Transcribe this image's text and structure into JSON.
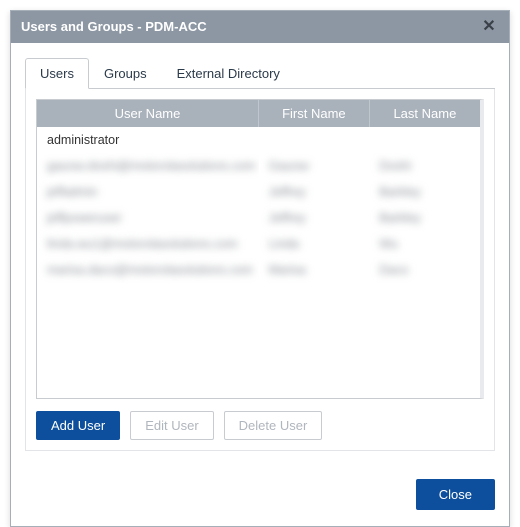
{
  "window": {
    "title": "Users and Groups - PDM-ACC",
    "close_glyph": "✕"
  },
  "tabs": [
    {
      "label": "Users",
      "active": true
    },
    {
      "label": "Groups",
      "active": false
    },
    {
      "label": "External Directory",
      "active": false
    }
  ],
  "table": {
    "columns": [
      "User Name",
      "First Name",
      "Last Name"
    ],
    "rows": [
      {
        "user": "administrator",
        "first": "",
        "last": "",
        "blurred": false
      },
      {
        "user": "gaurav.doshi@motorolasolutions.com",
        "first": "Gaurav",
        "last": "Doshi",
        "blurred": true
      },
      {
        "user": "jeffadmin",
        "first": "Jeffrey",
        "last": "Barkley",
        "blurred": true
      },
      {
        "user": "jeffpoweruser",
        "first": "Jeffrey",
        "last": "Barkley",
        "blurred": true
      },
      {
        "user": "linda.wu1@motorolasolutions.com",
        "first": "Linda",
        "last": "Wu",
        "blurred": true
      },
      {
        "user": "marisa.daco@motorolasolutions.com",
        "first": "Marisa",
        "last": "Daco",
        "blurred": true
      }
    ]
  },
  "actions": {
    "add": "Add User",
    "edit": "Edit User",
    "delete": "Delete User"
  },
  "footer": {
    "close": "Close"
  }
}
